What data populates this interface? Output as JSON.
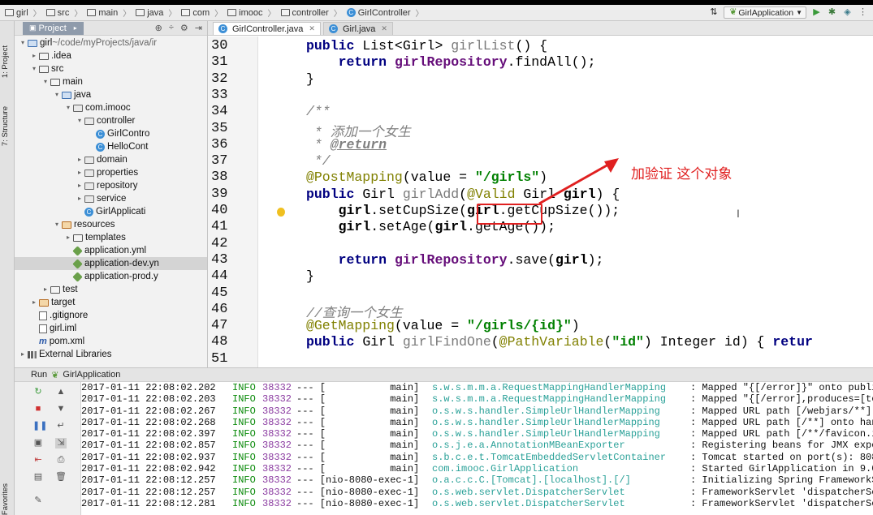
{
  "breadcrumbs": [
    "girl",
    "src",
    "main",
    "java",
    "com",
    "imooc",
    "controller",
    "GirlController"
  ],
  "run_config": "GirlApplication",
  "left_tools": [
    "1: Project",
    "7: Structure",
    "2: Favorites"
  ],
  "project": {
    "tab_label": "Project",
    "tree": [
      {
        "indent": 0,
        "arrow": "▾",
        "icon": "folder-blue",
        "label": "girl",
        "extra": " ~/code/myProjects/java/ir"
      },
      {
        "indent": 1,
        "arrow": "▸",
        "icon": "folder",
        "label": ".idea",
        "extra": ""
      },
      {
        "indent": 1,
        "arrow": "▾",
        "icon": "folder",
        "label": "src",
        "extra": ""
      },
      {
        "indent": 2,
        "arrow": "▾",
        "icon": "folder",
        "label": "main",
        "extra": ""
      },
      {
        "indent": 3,
        "arrow": "▾",
        "icon": "folder-blue",
        "label": "java",
        "extra": ""
      },
      {
        "indent": 4,
        "arrow": "▾",
        "icon": "pkg",
        "label": "com.imooc",
        "extra": ""
      },
      {
        "indent": 5,
        "arrow": "▾",
        "icon": "pkg",
        "label": "controller",
        "extra": ""
      },
      {
        "indent": 6,
        "arrow": "",
        "icon": "class",
        "label": "GirlContro",
        "extra": ""
      },
      {
        "indent": 6,
        "arrow": "",
        "icon": "class",
        "label": "HelloCont",
        "extra": ""
      },
      {
        "indent": 5,
        "arrow": "▸",
        "icon": "pkg",
        "label": "domain",
        "extra": ""
      },
      {
        "indent": 5,
        "arrow": "▸",
        "icon": "pkg",
        "label": "properties",
        "extra": ""
      },
      {
        "indent": 5,
        "arrow": "▸",
        "icon": "pkg",
        "label": "repository",
        "extra": ""
      },
      {
        "indent": 5,
        "arrow": "▸",
        "icon": "pkg",
        "label": "service",
        "extra": ""
      },
      {
        "indent": 5,
        "arrow": "",
        "icon": "class",
        "label": "GirlApplicati",
        "extra": ""
      },
      {
        "indent": 3,
        "arrow": "▾",
        "icon": "folder-orange",
        "label": "resources",
        "extra": ""
      },
      {
        "indent": 4,
        "arrow": "▸",
        "icon": "folder",
        "label": "templates",
        "extra": ""
      },
      {
        "indent": 4,
        "arrow": "",
        "icon": "yml",
        "label": "application.yml",
        "extra": ""
      },
      {
        "indent": 4,
        "arrow": "",
        "icon": "yml",
        "label": "application-dev.yn",
        "extra": "",
        "selected": true
      },
      {
        "indent": 4,
        "arrow": "",
        "icon": "yml",
        "label": "application-prod.y",
        "extra": ""
      },
      {
        "indent": 2,
        "arrow": "▸",
        "icon": "folder",
        "label": "test",
        "extra": ""
      },
      {
        "indent": 1,
        "arrow": "▸",
        "icon": "folder-orange",
        "label": "target",
        "extra": ""
      },
      {
        "indent": 1,
        "arrow": "",
        "icon": "file",
        "label": ".gitignore",
        "extra": ""
      },
      {
        "indent": 1,
        "arrow": "",
        "icon": "file",
        "label": "girl.iml",
        "extra": ""
      },
      {
        "indent": 1,
        "arrow": "",
        "icon": "maven",
        "label": "pom.xml",
        "extra": ""
      },
      {
        "indent": 0,
        "arrow": "▸",
        "icon": "lib",
        "label": "External Libraries",
        "extra": ""
      }
    ]
  },
  "editor": {
    "tabs": [
      {
        "label": "GirlController.java",
        "active": true
      },
      {
        "label": "Girl.java",
        "active": false
      }
    ],
    "lines": [
      {
        "n": "30",
        "html": "<span class='kw'>public</span> List&lt;Girl&gt; <span class='fn'>girlList</span>() {"
      },
      {
        "n": "31",
        "html": "    <span class='kw'>return</span> <span class='fld'>girlRepository</span>.findAll();"
      },
      {
        "n": "32",
        "html": "}"
      },
      {
        "n": "33",
        "html": ""
      },
      {
        "n": "34",
        "html": "<span class='cmt'>/**</span>"
      },
      {
        "n": "35",
        "html": "<span class='cmt'> * 添加一个女生</span>"
      },
      {
        "n": "36",
        "html": "<span class='cmt'> * </span><span class='cmtb'>@return</span>"
      },
      {
        "n": "37",
        "html": "<span class='cmt'> */</span>"
      },
      {
        "n": "38",
        "html": "<span class='ann'>@PostMapping</span>(value = <span class='str'>\"/girls\"</span>)"
      },
      {
        "n": "39",
        "html": "<span class='kw'>public</span> Girl <span class='fn'>girlAdd</span>(<span class='ann'>@Valid</span> Girl <span class='bold'>girl</span>) {"
      },
      {
        "n": "40",
        "html": "    <span class='bold'>girl</span>.setCupSize(<span class='bold'>girl</span>.getCupSize());"
      },
      {
        "n": "41",
        "html": "    <span class='bold'>girl</span>.setAge(<span class='bold'>girl</span>.getAge());"
      },
      {
        "n": "42",
        "html": ""
      },
      {
        "n": "43",
        "html": "    <span class='kw'>return</span> <span class='fld'>girlRepository</span>.save(<span class='bold'>girl</span>);"
      },
      {
        "n": "44",
        "html": "}"
      },
      {
        "n": "45",
        "html": ""
      },
      {
        "n": "46",
        "html": "<span class='cmt'>//查询一个女生</span>"
      },
      {
        "n": "47",
        "html": "<span class='ann'>@GetMapping</span>(value = <span class='str'>\"/girls/{id}\"</span>)"
      },
      {
        "n": "48",
        "html": "<span class='kw'>public</span> Girl <span class='fn'>girlFindOne</span>(<span class='ann'>@PathVariable</span>(<span class='str'>\"id\"</span>) Integer id) { <span class='kw'>retur</span>"
      },
      {
        "n": "51",
        "html": ""
      }
    ],
    "annotation_note": "加验证 这个对象"
  },
  "run": {
    "title": "Run",
    "config": "GirlApplication",
    "log": [
      {
        "ts": "2017-01-11 22:08:02.202",
        "lvl": "INFO",
        "pid": "38332",
        "thr": "--- [           main]",
        "cls": "s.w.s.m.m.a.RequestMappingHandlerMapping",
        "msg": ": Mapped \"{[/error]}\" onto publi"
      },
      {
        "ts": "2017-01-11 22:08:02.203",
        "lvl": "INFO",
        "pid": "38332",
        "thr": "--- [           main]",
        "cls": "s.w.s.m.m.a.RequestMappingHandlerMapping",
        "msg": ": Mapped \"{[/error],produces=[te"
      },
      {
        "ts": "2017-01-11 22:08:02.267",
        "lvl": "INFO",
        "pid": "38332",
        "thr": "--- [           main]",
        "cls": "o.s.w.s.handler.SimpleUrlHandlerMapping",
        "msg": ": Mapped URL path [/webjars/**]"
      },
      {
        "ts": "2017-01-11 22:08:02.268",
        "lvl": "INFO",
        "pid": "38332",
        "thr": "--- [           main]",
        "cls": "o.s.w.s.handler.SimpleUrlHandlerMapping",
        "msg": ": Mapped URL path [/**] onto han"
      },
      {
        "ts": "2017-01-11 22:08:02.397",
        "lvl": "INFO",
        "pid": "38332",
        "thr": "--- [           main]",
        "cls": "o.s.w.s.handler.SimpleUrlHandlerMapping",
        "msg": ": Mapped URL path [/**/favicon.i"
      },
      {
        "ts": "2017-01-11 22:08:02.857",
        "lvl": "INFO",
        "pid": "38332",
        "thr": "--- [           main]",
        "cls": "o.s.j.e.a.AnnotationMBeanExporter",
        "msg": ": Registering beans for JMX expo"
      },
      {
        "ts": "2017-01-11 22:08:02.937",
        "lvl": "INFO",
        "pid": "38332",
        "thr": "--- [           main]",
        "cls": "s.b.c.e.t.TomcatEmbeddedServletContainer",
        "msg": ": Tomcat started on port(s): 808"
      },
      {
        "ts": "2017-01-11 22:08:02.942",
        "lvl": "INFO",
        "pid": "38332",
        "thr": "--- [           main]",
        "cls": "com.imooc.GirlApplication",
        "msg": ": Started GirlApplication in 9.0"
      },
      {
        "ts": "2017-01-11 22:08:12.257",
        "lvl": "INFO",
        "pid": "38332",
        "thr": "--- [nio-8080-exec-1]",
        "cls": "o.a.c.c.C.[Tomcat].[localhost].[/]",
        "msg": ": Initializing Spring FrameworkS"
      },
      {
        "ts": "2017-01-11 22:08:12.257",
        "lvl": "INFO",
        "pid": "38332",
        "thr": "--- [nio-8080-exec-1]",
        "cls": "o.s.web.servlet.DispatcherServlet",
        "msg": ": FrameworkServlet 'dispatcherSe"
      },
      {
        "ts": "2017-01-11 22:08:12.281",
        "lvl": "INFO",
        "pid": "38332",
        "thr": "--- [nio-8080-exec-1]",
        "cls": "o.s.web.servlet.DispatcherServlet",
        "msg": ": FrameworkServlet 'dispatcherSe"
      }
    ]
  }
}
